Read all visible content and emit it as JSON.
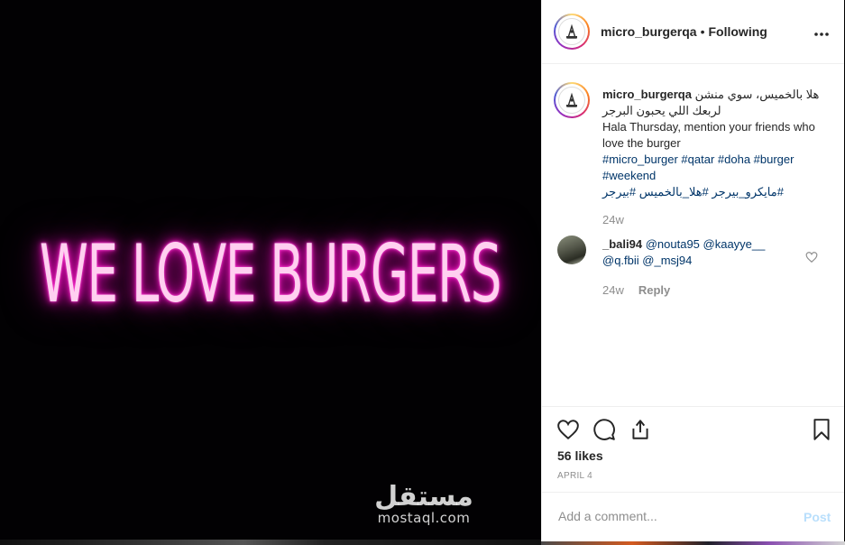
{
  "photo": {
    "neon_text": "WE LOVE BURGERS",
    "watermark_arabic": "مستقل",
    "watermark_latin": "mostaql.com"
  },
  "header": {
    "username": "micro_burgerqa",
    "separator": "•",
    "follow_status": "Following",
    "more_label": "..."
  },
  "caption": {
    "username": "micro_burgerqa",
    "arabic_line1": "هلا بالخميس، سوي منشن",
    "arabic_line2": "لربعك اللي يحبون البرجر",
    "english_text": "Hala Thursday, mention your friends who love the burger",
    "hashtags_line1": "#micro_burger #qatar #doha #burger",
    "hashtags_line2": "#weekend",
    "hashtags_arabic": "#مايكرو_بيرجر #هلا_بالخميس   #بيرجر",
    "time": "24w"
  },
  "comment": {
    "username": "_bali94",
    "mentions_line1": "@nouta95 @kaayye__",
    "mentions_line2": "@q.fbii @_msj94",
    "time": "24w",
    "reply_label": "Reply"
  },
  "actions": {
    "likes": "56 likes",
    "date": "APRIL 4"
  },
  "add_comment": {
    "placeholder": "Add a comment...",
    "post_label": "Post"
  },
  "icons": {
    "more": "more-options-icon",
    "like": "heart-icon",
    "comment": "comment-icon",
    "share": "share-icon",
    "save": "bookmark-icon"
  },
  "colors": {
    "neon_pink": "#ff1fc8",
    "text_primary": "#262626",
    "text_secondary": "#8e8e8e",
    "link": "#003569",
    "post_disabled": "#b9dffc",
    "divider": "#efefef"
  }
}
